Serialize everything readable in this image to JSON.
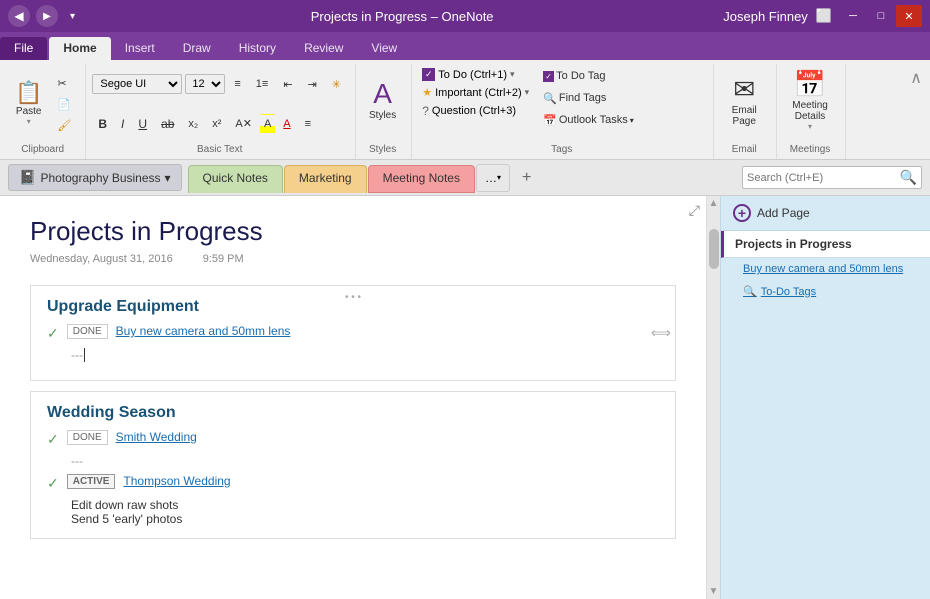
{
  "titlebar": {
    "app_name": "OneNote",
    "doc_title": "Projects in Progress",
    "full_title": "Projects in Progress  –  OneNote",
    "user_name": "Joseph Finney"
  },
  "ribbon_tabs": {
    "file": "File",
    "home": "Home",
    "insert": "Insert",
    "draw": "Draw",
    "history": "History",
    "review": "Review",
    "view": "View"
  },
  "ribbon": {
    "clipboard_label": "Clipboard",
    "basic_text_label": "Basic Text",
    "styles_label": "Styles",
    "tags_label": "Tags",
    "email_label": "Email",
    "meetings_label": "Meetings",
    "paste_label": "Paste",
    "font": "Segoe UI",
    "font_size": "12",
    "styles_btn": "Styles",
    "tags": {
      "todo": "To Do (Ctrl+1)",
      "important": "Important (Ctrl+2)",
      "question": "Question (Ctrl+3)",
      "todo_tag": "To Do Tag",
      "find_tags": "Find Tags",
      "outlook_tasks": "Outlook Tasks"
    },
    "email_page": "Email\nPage",
    "meeting_details": "Meeting\nDetails"
  },
  "notebook": {
    "name": "Photography Business",
    "dropdown_icon": "▾"
  },
  "section_tabs": [
    {
      "label": "Quick Notes",
      "color": "#c8e0b0",
      "active": false
    },
    {
      "label": "Marketing",
      "color": "#f5d08c",
      "active": false
    },
    {
      "label": "Meeting Notes",
      "color": "#f5a0a0",
      "active": false
    }
  ],
  "search": {
    "placeholder": "Search (Ctrl+E)"
  },
  "page": {
    "title": "Projects in Progress",
    "date": "Wednesday, August 31, 2016",
    "time": "9:59 PM"
  },
  "content": {
    "block1": {
      "heading": "Upgrade Equipment",
      "task1_status": "DONE",
      "task1_link": "Buy new camera and 50mm lens"
    },
    "block2": {
      "heading": "Wedding Season",
      "task1_status": "DONE",
      "task1_link": "Smith Wedding",
      "task2_status": "ACTIVE",
      "task2_link": "Thompson Wedding",
      "task2_line1": "Edit down raw shots",
      "task2_line2": "Send 5 'early' photos"
    }
  },
  "pages_panel": {
    "add_page_label": "Add Page",
    "page1": "Projects in Progress",
    "page2_link": "Buy new camera and 50mm lens",
    "page3_link": "To-Do Tags"
  }
}
